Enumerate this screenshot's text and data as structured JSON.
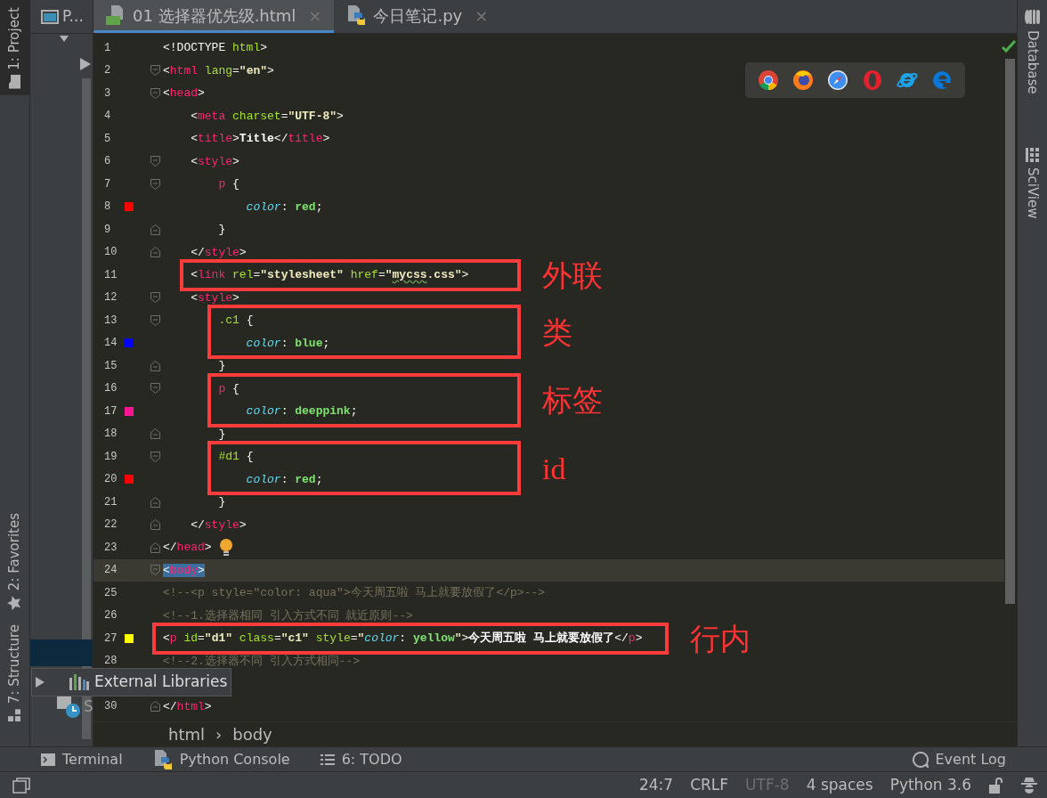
{
  "left_strip": [
    {
      "label": "1: Project",
      "kind": "project",
      "selected": true
    },
    {
      "label": "2: Favorites",
      "kind": "favorites",
      "selected": false
    },
    {
      "label": "7: Structure",
      "kind": "structure",
      "selected": false
    }
  ],
  "project_panel": {
    "title": "P...",
    "items": [
      {
        "label": "External Libraries",
        "kind": "libraries"
      },
      {
        "label": "S",
        "kind": "scratches"
      }
    ]
  },
  "tabs": [
    {
      "label": "01 选择器优先级.html",
      "kind": "html",
      "selected": true,
      "close": "×"
    },
    {
      "label": "今日笔记.py",
      "kind": "python",
      "selected": false,
      "close": "×"
    }
  ],
  "code": [
    {
      "kind": "plain",
      "n": "1",
      "current": false,
      "tokens": [
        {
          "text": "<!DOCTYPE ",
          "kind": "punct"
        },
        {
          "text": "html",
          "kind": "attr"
        },
        {
          "text": ">",
          "kind": "punct"
        }
      ]
    },
    {
      "kind": "opener",
      "n": "2",
      "current": false,
      "tokens": [
        {
          "text": "<",
          "kind": "punct"
        },
        {
          "text": "html",
          "kind": "tag"
        },
        {
          "text": " lang",
          "kind": "attr"
        },
        {
          "text": "=",
          "kind": "punct"
        },
        {
          "text": "\"en\"",
          "kind": "string"
        },
        {
          "text": ">",
          "kind": "punct"
        }
      ]
    },
    {
      "kind": "opener",
      "n": "3",
      "current": false,
      "tokens": [
        {
          "text": "<",
          "kind": "punct"
        },
        {
          "text": "head",
          "kind": "tag"
        },
        {
          "text": ">",
          "kind": "punct"
        }
      ]
    },
    {
      "kind": "plain",
      "n": "4",
      "current": false,
      "tokens": [
        {
          "text": "    <",
          "kind": "punct"
        },
        {
          "text": "meta",
          "kind": "tag"
        },
        {
          "text": " charset",
          "kind": "attr"
        },
        {
          "text": "=",
          "kind": "punct"
        },
        {
          "text": "\"UTF-8\"",
          "kind": "string"
        },
        {
          "text": ">",
          "kind": "punct"
        }
      ]
    },
    {
      "kind": "plain",
      "n": "5",
      "current": false,
      "tokens": [
        {
          "text": "    <",
          "kind": "punct"
        },
        {
          "text": "title",
          "kind": "tag"
        },
        {
          "text": ">",
          "kind": "punct"
        },
        {
          "text": "Title",
          "kind": "text"
        },
        {
          "text": "</",
          "kind": "punct"
        },
        {
          "text": "title",
          "kind": "tag"
        },
        {
          "text": ">",
          "kind": "punct"
        }
      ]
    },
    {
      "kind": "opener",
      "n": "6",
      "current": false,
      "tokens": [
        {
          "text": "    <",
          "kind": "punct"
        },
        {
          "text": "style",
          "kind": "tag"
        },
        {
          "text": ">",
          "kind": "punct"
        }
      ]
    },
    {
      "kind": "opener",
      "n": "7",
      "current": false,
      "tokens": [
        {
          "text": "        p",
          "kind": "tag"
        },
        {
          "text": " {",
          "kind": "punct"
        }
      ]
    },
    {
      "kind": "plain",
      "n": "8",
      "current": false,
      "color": "#ff0000",
      "tokens": [
        {
          "text": "            color",
          "kind": "prop"
        },
        {
          "text": ": ",
          "kind": "punct"
        },
        {
          "text": "red",
          "kind": "value"
        },
        {
          "text": ";",
          "kind": "punct"
        }
      ]
    },
    {
      "kind": "closer",
      "n": "9",
      "current": false,
      "tokens": [
        {
          "text": "        }",
          "kind": "punct"
        }
      ]
    },
    {
      "kind": "closer",
      "n": "10",
      "current": false,
      "tokens": [
        {
          "text": "    </",
          "kind": "punct"
        },
        {
          "text": "style",
          "kind": "tag"
        },
        {
          "text": ">",
          "kind": "punct"
        }
      ]
    },
    {
      "kind": "callout",
      "label": "外联",
      "lines": [
        {
          "kind": "plain",
          "n": "11",
          "current": false,
          "tokens": [
            {
              "text": "    <",
              "kind": "punct"
            },
            {
              "text": "link",
              "kind": "tag"
            },
            {
              "text": " rel",
              "kind": "attr"
            },
            {
              "text": "=",
              "kind": "punct"
            },
            {
              "text": "\"stylesheet\"",
              "kind": "string"
            },
            {
              "text": " href",
              "kind": "attr"
            },
            {
              "text": "=",
              "kind": "punct"
            },
            {
              "text": "\"",
              "kind": "string"
            },
            {
              "text": "mycss",
              "kind": "string",
              "warning": true
            },
            {
              "text": ".css\"",
              "kind": "string"
            },
            {
              "text": ">",
              "kind": "punct"
            }
          ]
        }
      ]
    },
    {
      "kind": "opener",
      "n": "12",
      "current": false,
      "tokens": [
        {
          "text": "    <",
          "kind": "punct"
        },
        {
          "text": "style",
          "kind": "tag"
        },
        {
          "text": ">",
          "kind": "punct"
        }
      ]
    },
    {
      "kind": "callout",
      "label": "类",
      "lines": [
        {
          "kind": "opener",
          "n": "13",
          "current": false,
          "tokens": [
            {
              "text": "        .c1",
              "kind": "attr"
            },
            {
              "text": " {",
              "kind": "punct"
            }
          ]
        },
        {
          "kind": "plain",
          "n": "14",
          "current": false,
          "color": "#0000ff",
          "tokens": [
            {
              "text": "            color",
              "kind": "prop"
            },
            {
              "text": ": ",
              "kind": "punct"
            },
            {
              "text": "blue",
              "kind": "value"
            },
            {
              "text": ";",
              "kind": "punct"
            }
          ]
        }
      ]
    },
    {
      "kind": "closer",
      "n": "15",
      "current": false,
      "tokens": [
        {
          "text": "        }",
          "kind": "punct"
        }
      ]
    },
    {
      "kind": "callout",
      "label": "标签",
      "lines": [
        {
          "kind": "opener",
          "n": "16",
          "current": false,
          "tokens": [
            {
              "text": "        p",
              "kind": "tag"
            },
            {
              "text": " {",
              "kind": "punct"
            }
          ]
        },
        {
          "kind": "plain",
          "n": "17",
          "current": false,
          "color": "#ff1493",
          "tokens": [
            {
              "text": "            color",
              "kind": "prop"
            },
            {
              "text": ": ",
              "kind": "punct"
            },
            {
              "text": "deeppink",
              "kind": "value"
            },
            {
              "text": ";",
              "kind": "punct"
            }
          ]
        }
      ]
    },
    {
      "kind": "closer",
      "n": "18",
      "current": false,
      "tokens": [
        {
          "text": "        }",
          "kind": "punct"
        }
      ]
    },
    {
      "kind": "callout",
      "label": "id",
      "lines": [
        {
          "kind": "opener",
          "n": "19",
          "current": false,
          "tokens": [
            {
              "text": "        #d1",
              "kind": "attr"
            },
            {
              "text": " {",
              "kind": "punct"
            }
          ]
        },
        {
          "kind": "plain",
          "n": "20",
          "current": false,
          "color": "#ff0000",
          "tokens": [
            {
              "text": "            color",
              "kind": "prop"
            },
            {
              "text": ": ",
              "kind": "punct"
            },
            {
              "text": "red",
              "kind": "value"
            },
            {
              "text": ";",
              "kind": "punct"
            }
          ]
        }
      ]
    },
    {
      "kind": "closer",
      "n": "21",
      "current": false,
      "tokens": [
        {
          "text": "        }",
          "kind": "punct"
        }
      ]
    },
    {
      "kind": "closer",
      "n": "22",
      "current": false,
      "tokens": [
        {
          "text": "    </",
          "kind": "punct"
        },
        {
          "text": "style",
          "kind": "tag"
        },
        {
          "text": ">",
          "kind": "punct"
        }
      ]
    },
    {
      "kind": "closer",
      "n": "23",
      "current": false,
      "bulb": true,
      "tokens": [
        {
          "text": "</",
          "kind": "punct"
        },
        {
          "text": "head",
          "kind": "tag"
        },
        {
          "text": ">",
          "kind": "punct"
        }
      ]
    },
    {
      "kind": "opener",
      "n": "24",
      "current": true,
      "tokens": [
        {
          "text": "<",
          "kind": "punct",
          "highlighted": true
        },
        {
          "text": "body",
          "kind": "tag",
          "highlighted": true
        },
        {
          "text": ">",
          "kind": "punct",
          "highlighted": true
        }
      ]
    },
    {
      "kind": "plain",
      "n": "25",
      "current": false,
      "tokens": [
        {
          "text": "<!--<p style=\"color: aqua\">今天周五啦 马上就要放假了</p>-->",
          "kind": "comment"
        }
      ]
    },
    {
      "kind": "plain",
      "n": "26",
      "current": false,
      "tokens": [
        {
          "text": "<!--1.选择器相同 引入方式不同 就近原则-->",
          "kind": "comment"
        }
      ]
    },
    {
      "kind": "callout",
      "label": "行内",
      "lines": [
        {
          "kind": "plain",
          "n": "27",
          "current": false,
          "color": "#ffff00",
          "tokens": [
            {
              "text": "<",
              "kind": "punct"
            },
            {
              "text": "p",
              "kind": "tag"
            },
            {
              "text": " id",
              "kind": "attr"
            },
            {
              "text": "=",
              "kind": "punct"
            },
            {
              "text": "\"d1\"",
              "kind": "string"
            },
            {
              "text": " class",
              "kind": "attr"
            },
            {
              "text": "=",
              "kind": "punct"
            },
            {
              "text": "\"c1\"",
              "kind": "string"
            },
            {
              "text": " style",
              "kind": "attr"
            },
            {
              "text": "=",
              "kind": "punct"
            },
            {
              "text": "\"",
              "kind": "string"
            },
            {
              "text": "color",
              "kind": "prop"
            },
            {
              "text": ": ",
              "kind": "punct"
            },
            {
              "text": "yellow",
              "kind": "value"
            },
            {
              "text": "\"",
              "kind": "string"
            },
            {
              "text": ">",
              "kind": "punct"
            },
            {
              "text": "今天周五啦 马上就要放假了",
              "kind": "text"
            },
            {
              "text": "</",
              "kind": "punct"
            },
            {
              "text": "p",
              "kind": "tag"
            },
            {
              "text": ">",
              "kind": "punct"
            }
          ]
        }
      ]
    },
    {
      "kind": "plain",
      "n": "28",
      "current": false,
      "tokens": [
        {
          "text": "<!--2.选择器不同 引入方式相同-->",
          "kind": "comment"
        }
      ]
    },
    {
      "kind": "plain",
      "current": false
    },
    {
      "kind": "closer",
      "n": "30",
      "current": false,
      "tokens": [
        {
          "text": "</",
          "kind": "punct"
        },
        {
          "text": "html",
          "kind": "tag"
        },
        {
          "text": ">",
          "kind": "punct"
        }
      ]
    }
  ],
  "breadcrumb": {
    "items": [
      "html",
      "body"
    ],
    "separator": "›"
  },
  "right_strip": [
    {
      "label": "Database",
      "kind": "database"
    },
    {
      "label": "SciView",
      "kind": "sciview"
    }
  ],
  "tool_windows": [
    {
      "label": "Terminal",
      "kind": "terminal"
    },
    {
      "label": "Python Console",
      "kind": "python"
    },
    {
      "label": "6: TODO",
      "kind": "todo"
    }
  ],
  "event_log": "Event Log",
  "status": [
    {
      "text": "24:7",
      "disabled": false
    },
    {
      "text": "CRLF",
      "disabled": false
    },
    {
      "text": "UTF-8",
      "disabled": true
    },
    {
      "text": "4 spaces",
      "disabled": false
    },
    {
      "text": "Python 3.6",
      "disabled": false
    }
  ]
}
